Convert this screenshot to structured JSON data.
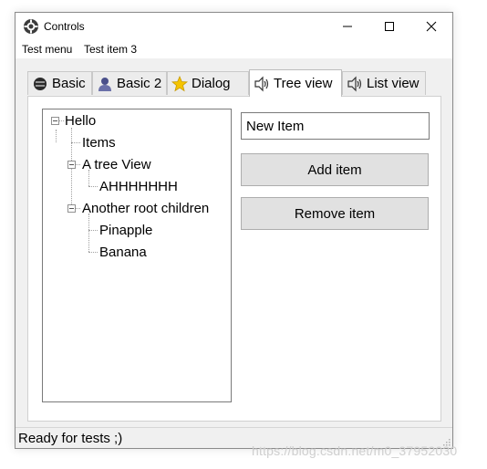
{
  "window": {
    "title": "Controls"
  },
  "menu": [
    {
      "label": "Test menu"
    },
    {
      "label": "Test item 3"
    }
  ],
  "tabs": [
    {
      "label": "Basic",
      "icon": "database-icon"
    },
    {
      "label": "Basic 2",
      "icon": "user-icon"
    },
    {
      "label": "Dialog",
      "icon": "star-icon"
    },
    {
      "label": "Tree view",
      "icon": "speaker-icon",
      "active": true
    },
    {
      "label": "List view",
      "icon": "speaker-icon"
    }
  ],
  "tree": {
    "nodes": [
      {
        "label": "Hello",
        "level": 0,
        "expanded": true
      },
      {
        "label": "Items",
        "level": 1
      },
      {
        "label": "A tree View",
        "level": 1,
        "expanded": true
      },
      {
        "label": "AHHHHHHH",
        "level": 2
      },
      {
        "label": "Another root children",
        "level": 1,
        "expanded": true
      },
      {
        "label": "Pinapple",
        "level": 2
      },
      {
        "label": "Banana",
        "level": 2
      }
    ]
  },
  "form": {
    "input_value": "New Item",
    "add_label": "Add item",
    "remove_label": "Remove item"
  },
  "status": {
    "text": "Ready for tests ;)"
  },
  "watermark": "https://blog.csdn.net/m0_37952030"
}
